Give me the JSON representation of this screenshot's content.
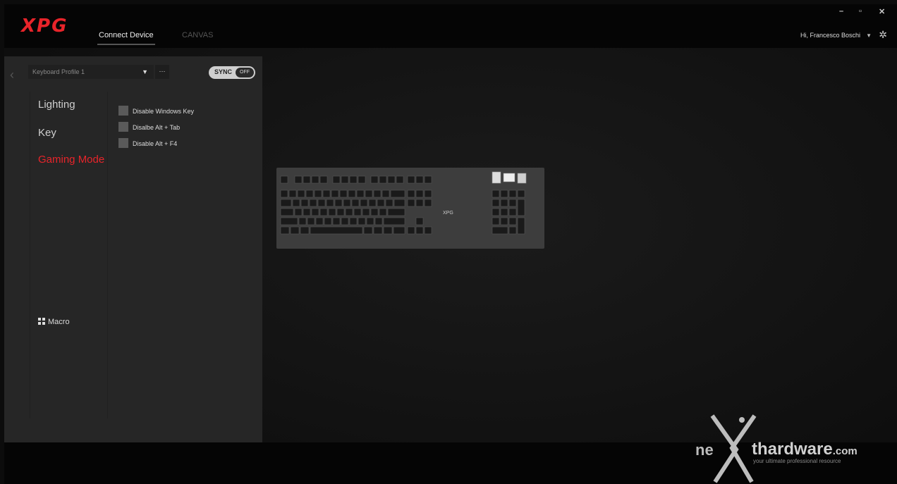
{
  "header": {
    "logo": "XPG",
    "tabs": [
      {
        "label": "Connect Device",
        "active": true
      },
      {
        "label": "CANVAS",
        "active": false
      }
    ],
    "user_greeting": "Hi, Francesco Boschi",
    "window_controls": [
      "–",
      "▫",
      "✕"
    ],
    "accent_color": "#e8242a"
  },
  "panel": {
    "profile": {
      "selected": "Keyboard Profile 1",
      "more_label": "···"
    },
    "sync": {
      "label": "SYNC",
      "state": "OFF"
    },
    "nav": [
      {
        "label": "Lighting",
        "active": false
      },
      {
        "label": "Key",
        "active": false
      },
      {
        "label": "Gaming Mode",
        "active": true
      }
    ],
    "options": [
      {
        "label": "Disable Windows Key",
        "checked": false
      },
      {
        "label": "Disalbe Alt + Tab",
        "checked": false
      },
      {
        "label": "Disable Alt + F4",
        "checked": false
      }
    ],
    "macro_label": "Macro"
  },
  "keyboard": {
    "brand_text": "XPG"
  },
  "watermark": {
    "prefix": "ne",
    "site": "thardware",
    "tld": ".com",
    "tagline": "your ultimate professional resource"
  }
}
